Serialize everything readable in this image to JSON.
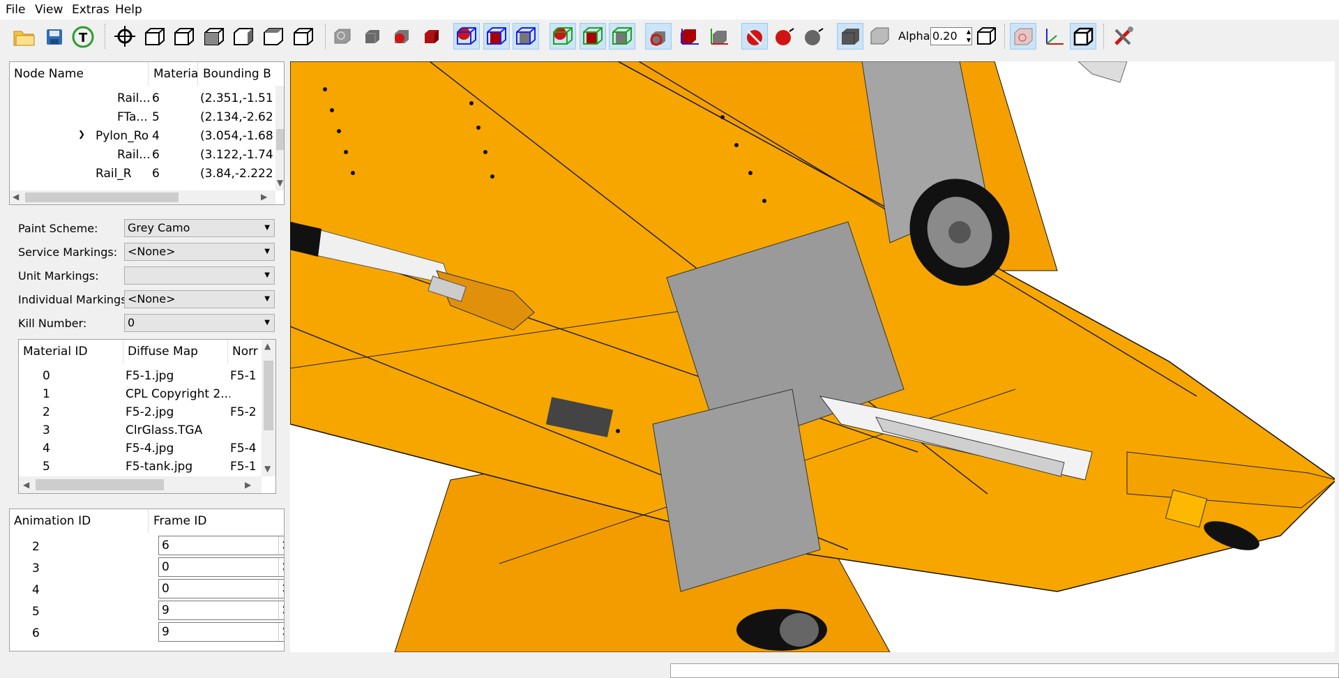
{
  "menu": [
    "File",
    "View",
    "Extras",
    "Help"
  ],
  "toolbar": {
    "alpha_label": "Alpha:",
    "alpha_value": "0.20"
  },
  "node_tree": {
    "columns": [
      "Node Name",
      "Materia",
      "Bounding B"
    ],
    "rows": [
      {
        "name": "Rail...",
        "mat": "6",
        "bounds": "(2.351,-1.51"
      },
      {
        "name": "FTa...",
        "mat": "5",
        "bounds": "(2.134,-2.62"
      },
      {
        "name": "Pylon_Ro",
        "mat": "4",
        "bounds": "(3.054,-1.68"
      },
      {
        "name": "Rail...",
        "mat": "6",
        "bounds": "(3.122,-1.74"
      },
      {
        "name": "Rail_R",
        "mat": "6",
        "bounds": "(3.84,-2.222"
      }
    ]
  },
  "markings": {
    "paint_scheme": {
      "label": "Paint Scheme:",
      "value": "Grey Camo"
    },
    "service": {
      "label": "Service Markings:",
      "value": "<None>"
    },
    "unit": {
      "label": "Unit Markings:",
      "value": ""
    },
    "individual": {
      "label": "Individual Markings:",
      "value": "<None>"
    },
    "kill": {
      "label": "Kill Number:",
      "value": "0"
    }
  },
  "materials": {
    "columns": [
      "Material ID",
      "Diffuse Map",
      "Norr"
    ],
    "rows": [
      {
        "id": "0",
        "diffuse": "F5-1.jpg",
        "normal": "F5-1"
      },
      {
        "id": "1",
        "diffuse": "CPL Copyright 2...",
        "normal": ""
      },
      {
        "id": "2",
        "diffuse": "F5-2.jpg",
        "normal": "F5-2"
      },
      {
        "id": "3",
        "diffuse": "ClrGlass.TGA",
        "normal": ""
      },
      {
        "id": "4",
        "diffuse": "F5-4.jpg",
        "normal": "F5-4"
      },
      {
        "id": "5",
        "diffuse": "F5-tank.jpg",
        "normal": "F5-1"
      }
    ]
  },
  "animations": {
    "columns": [
      "Animation ID",
      "Frame ID"
    ],
    "rows": [
      {
        "id": "2",
        "frame": "6"
      },
      {
        "id": "3",
        "frame": "0"
      },
      {
        "id": "4",
        "frame": "0"
      },
      {
        "id": "5",
        "frame": "9"
      },
      {
        "id": "6",
        "frame": "9"
      }
    ]
  },
  "colors": {
    "airframe": "#f5a000",
    "accent_selected": "#cce4f7"
  }
}
